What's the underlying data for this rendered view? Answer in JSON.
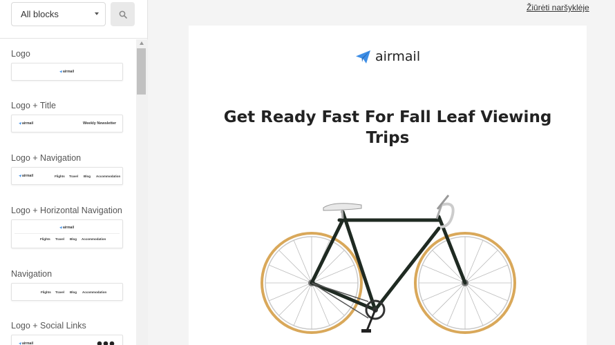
{
  "sidebar": {
    "filter": {
      "selected": "All blocks"
    },
    "blocks": [
      {
        "label": "Logo",
        "preview": {
          "logo": "airmail"
        }
      },
      {
        "label": "Logo + Title",
        "preview": {
          "logo": "airmail",
          "title": "Weekly Newsletter"
        }
      },
      {
        "label": "Logo + Navigation",
        "preview": {
          "logo": "airmail",
          "nav": [
            "Flights",
            "Travel",
            "Blog",
            "Accommodation"
          ]
        }
      },
      {
        "label": "Logo + Horizontal Navigation",
        "preview": {
          "logo": "airmail",
          "nav": [
            "Flights",
            "Travel",
            "Blog",
            "Accommodation"
          ]
        }
      },
      {
        "label": "Navigation",
        "preview": {
          "nav": [
            "Flights",
            "Travel",
            "Blog",
            "Accommodation"
          ]
        }
      },
      {
        "label": "Logo + Social Links",
        "preview": {
          "logo": "airmail"
        }
      }
    ]
  },
  "main": {
    "browser_link": "Žiūrėti naršyklėje",
    "email": {
      "brand": "airmail",
      "headline": "Get Ready Fast For Fall Leaf Viewing Trips",
      "hero_image": "bicycle-image"
    }
  },
  "colors": {
    "brand_accent": "#3d8ee6",
    "tire": "#d9a85a",
    "frame": "#1f2a22"
  },
  "icons": {
    "search": "search-icon",
    "plane": "paper-plane-icon",
    "dropdown": "chevron-down-icon"
  }
}
